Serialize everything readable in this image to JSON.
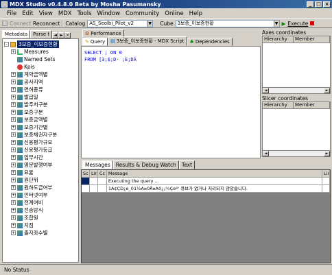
{
  "window": {
    "title": "MDX Studio v0.4.8.0 Beta by Mosha Pasumansky"
  },
  "menu": [
    "File",
    "Edit",
    "View",
    "MDX",
    "Tools",
    "Window",
    "Community",
    "Online",
    "Help"
  ],
  "toolbar": {
    "connect": "Connect",
    "reconnect": "Reconnect",
    "catalog_label": "Catalog",
    "catalog_value": "AS_Seolbi_Pilot_v2",
    "cube_label": "Cube",
    "cube_value": "3보증_이보증현황",
    "execute": "Execute"
  },
  "left": {
    "tabs": [
      "Metadata",
      "Parse t"
    ],
    "tree": [
      {
        "label": "3보증_이보증현황",
        "type": "cube",
        "selected": true,
        "exp": "-"
      },
      {
        "label": "Measures",
        "type": "measures",
        "exp": "+"
      },
      {
        "label": "Named Sets",
        "type": "sets",
        "exp": ""
      },
      {
        "label": "Kpis",
        "type": "kpi",
        "exp": ""
      },
      {
        "label": "계약금액별",
        "type": "dim",
        "exp": "+"
      },
      {
        "label": "공사지역",
        "type": "dim",
        "exp": "+"
      },
      {
        "label": "면허종류",
        "type": "dim",
        "exp": "+"
      },
      {
        "label": "발급일",
        "type": "dim",
        "exp": "+"
      },
      {
        "label": "발주처구분",
        "type": "dim",
        "exp": "+"
      },
      {
        "label": "보증구분",
        "type": "dim",
        "exp": "+"
      },
      {
        "label": "보증금액별",
        "type": "dim",
        "exp": "+"
      },
      {
        "label": "보증기간별",
        "type": "dim",
        "exp": "+"
      },
      {
        "label": "보증채권자구분",
        "type": "dim",
        "exp": "+"
      },
      {
        "label": "신용평가규모",
        "type": "dim",
        "exp": "+"
      },
      {
        "label": "신용평가등급",
        "type": "dim",
        "exp": "+"
      },
      {
        "label": "업무시간",
        "type": "dim",
        "exp": "+"
      },
      {
        "label": "영문발행여부",
        "type": "dim",
        "exp": "+"
      },
      {
        "label": "요율",
        "type": "dim",
        "exp": "+"
      },
      {
        "label": "원단위",
        "type": "dim",
        "exp": "+"
      },
      {
        "label": "원하도급여부",
        "type": "dim",
        "exp": "+"
      },
      {
        "label": "인터넷여부",
        "type": "dim",
        "exp": "+"
      },
      {
        "label": "전계여비",
        "type": "dim",
        "exp": "+"
      },
      {
        "label": "전송방식",
        "type": "dim",
        "exp": "+"
      },
      {
        "label": "조합원",
        "type": "dim",
        "exp": "+"
      },
      {
        "label": "지점",
        "type": "dim",
        "exp": "+"
      },
      {
        "label": "출자좌수별",
        "type": "dim",
        "exp": "+"
      }
    ]
  },
  "editor": {
    "tab_performance": "Performance",
    "tab_query": "Query",
    "tab_script": "3보증_이보증현황 - MDX Script",
    "tab_dependencies": "Dependencies",
    "code_line1": "SELECT ; ON 0",
    "code_line2": "FROM [3;$;D· ;E;DÁ"
  },
  "right": {
    "axes_title": "Axes coordinates",
    "slicer_title": "Slicer coordinates",
    "col_hierarchy": "Hierarchy",
    "col_member": "Member"
  },
  "messages": {
    "tabs": [
      "Messages",
      "Results & Debug Watch",
      "Text"
    ],
    "headers": {
      "sc": "Sc",
      "ln": "Lir",
      "cc": "Cc",
      "msg": "Message",
      "ln2": "Lir"
    },
    "rows": [
      {
        "msg": "Executing the query ..."
      },
      {
        "msg": "1A¢ÇD¿e_01½A¤0Ã¤A0¿¡¾Çeº' 큐브가 없거나 처리되지 않았습니다."
      }
    ]
  },
  "status": {
    "text": "No Status"
  }
}
